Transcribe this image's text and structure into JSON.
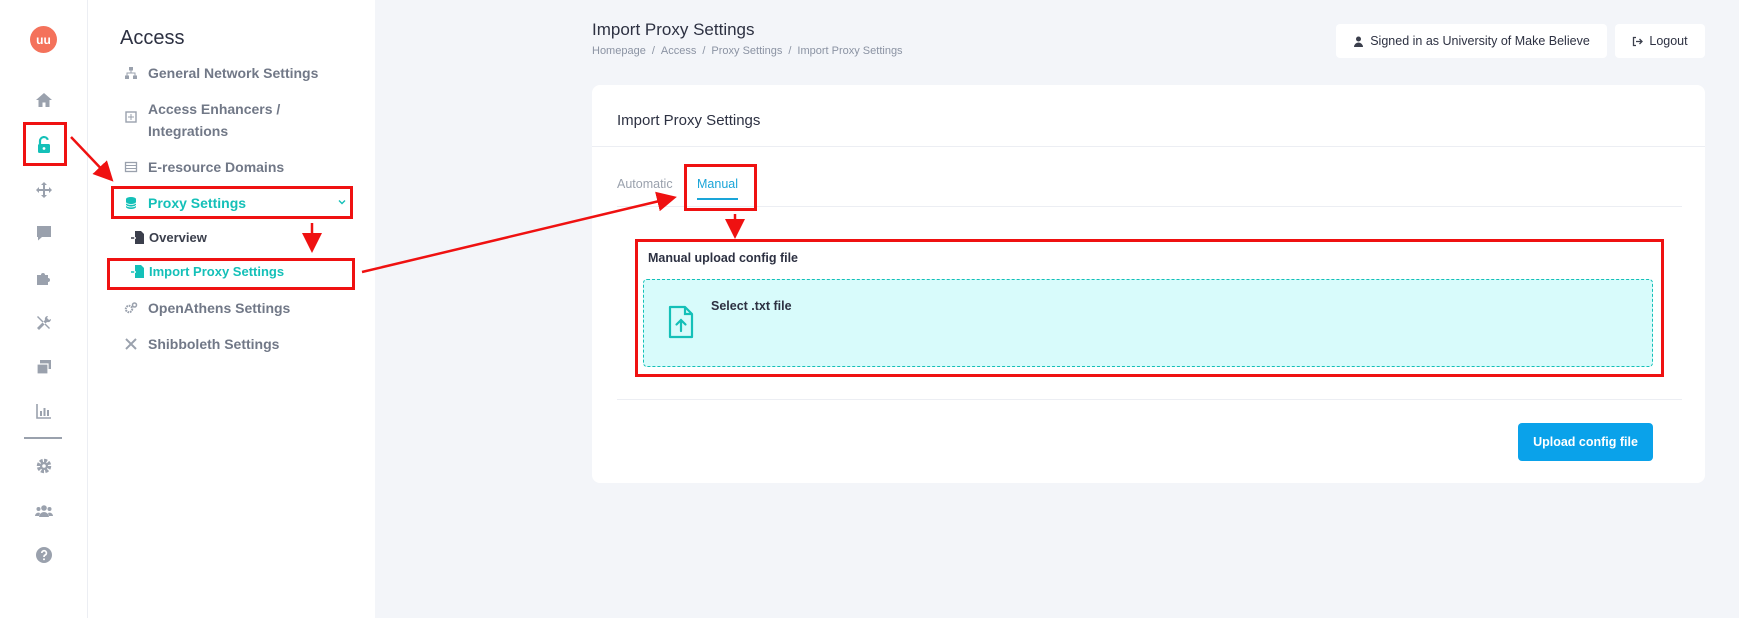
{
  "logo": {
    "text": "uu"
  },
  "rail": {
    "items": [
      {
        "name": "home-icon"
      },
      {
        "name": "unlock-icon",
        "active": true
      },
      {
        "name": "move-icon"
      },
      {
        "name": "chat-icon"
      },
      {
        "name": "puzzle-icon"
      },
      {
        "name": "tools-icon"
      },
      {
        "name": "windows-icon"
      },
      {
        "name": "chart-icon"
      },
      {
        "name": "gear-icon"
      },
      {
        "name": "users-icon"
      },
      {
        "name": "help-icon"
      }
    ]
  },
  "submenu": {
    "title": "Access",
    "items": [
      {
        "label": "General Network Settings"
      },
      {
        "label": "Access Enhancers /",
        "label2": "Integrations"
      },
      {
        "label": "E-resource Domains"
      },
      {
        "label": "Proxy Settings"
      },
      {
        "label": "OpenAthens Settings"
      },
      {
        "label": "Shibboleth Settings"
      }
    ],
    "proxy_sub": [
      {
        "label": "Overview"
      },
      {
        "label": "Import Proxy Settings"
      }
    ]
  },
  "header": {
    "title": "Import Proxy Settings",
    "breadcrumb": [
      "Homepage",
      "Access",
      "Proxy Settings",
      "Import Proxy Settings"
    ],
    "signed_in": "Signed in as University of Make Believe",
    "logout": "Logout"
  },
  "card": {
    "title": "Import Proxy Settings",
    "tabs": [
      {
        "label": "Automatic"
      },
      {
        "label": "Manual"
      }
    ],
    "upload_label": "Manual upload config file",
    "dropzone_text": "Select .txt file",
    "upload_button": "Upload config file"
  },
  "colors": {
    "accent": "#14c0b8",
    "primary_button": "#0aa2ea",
    "annotation": "#ef1111"
  }
}
